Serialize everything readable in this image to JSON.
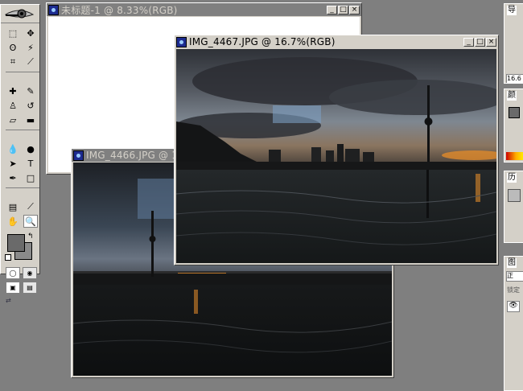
{
  "toolbox": {
    "logo": "eye-logo",
    "tools": [
      {
        "icon": "marquee-icon",
        "glyph": "⬚"
      },
      {
        "icon": "move-icon",
        "glyph": "✥"
      },
      {
        "icon": "lasso-icon",
        "glyph": "ʘ"
      },
      {
        "icon": "magic-wand-icon",
        "glyph": "⚡"
      },
      {
        "icon": "crop-icon",
        "glyph": "⌗"
      },
      {
        "icon": "slice-icon",
        "glyph": "⟋"
      },
      {
        "icon": "healing-brush-icon",
        "glyph": "✚"
      },
      {
        "icon": "brush-icon",
        "glyph": "✎"
      },
      {
        "icon": "clone-stamp-icon",
        "glyph": "♙"
      },
      {
        "icon": "history-brush-icon",
        "glyph": "↺"
      },
      {
        "icon": "eraser-icon",
        "glyph": "▱"
      },
      {
        "icon": "gradient-icon",
        "glyph": "▬"
      },
      {
        "icon": "blur-icon",
        "glyph": "💧"
      },
      {
        "icon": "dodge-icon",
        "glyph": "●"
      },
      {
        "icon": "path-select-icon",
        "glyph": "➤"
      },
      {
        "icon": "type-icon",
        "glyph": "T"
      },
      {
        "icon": "pen-icon",
        "glyph": "✒"
      },
      {
        "icon": "shape-icon",
        "glyph": "□"
      },
      {
        "icon": "notes-icon",
        "glyph": "▤"
      },
      {
        "icon": "eyedropper-icon",
        "glyph": "⟋"
      },
      {
        "icon": "hand-icon",
        "glyph": "✋"
      },
      {
        "icon": "zoom-icon",
        "glyph": "🔍",
        "selected": true
      }
    ]
  },
  "windows": {
    "untitled": {
      "title": "未标题-1 @ 8.33%(RGB)"
    },
    "img4466": {
      "title": "IMG_4466.JPG @ 16.7%(RGB)"
    },
    "img4467": {
      "title": "IMG_4467.JPG @ 16.7%(RGB)"
    }
  },
  "window_buttons": {
    "minimize": "_",
    "maximize": "□",
    "close": "×"
  },
  "dock": {
    "navigator_tab": "导",
    "zoom_value": "16.6",
    "color_tab": "颜",
    "history_tab": "历",
    "layers_tab": "图",
    "layers_mode": "正",
    "layers_lock": "锁定"
  },
  "colors": {
    "sky": "#7a96b6",
    "cloud_dark": "#2b2d33",
    "water": "#1a1c1d",
    "sunset": "#e08a2a"
  }
}
